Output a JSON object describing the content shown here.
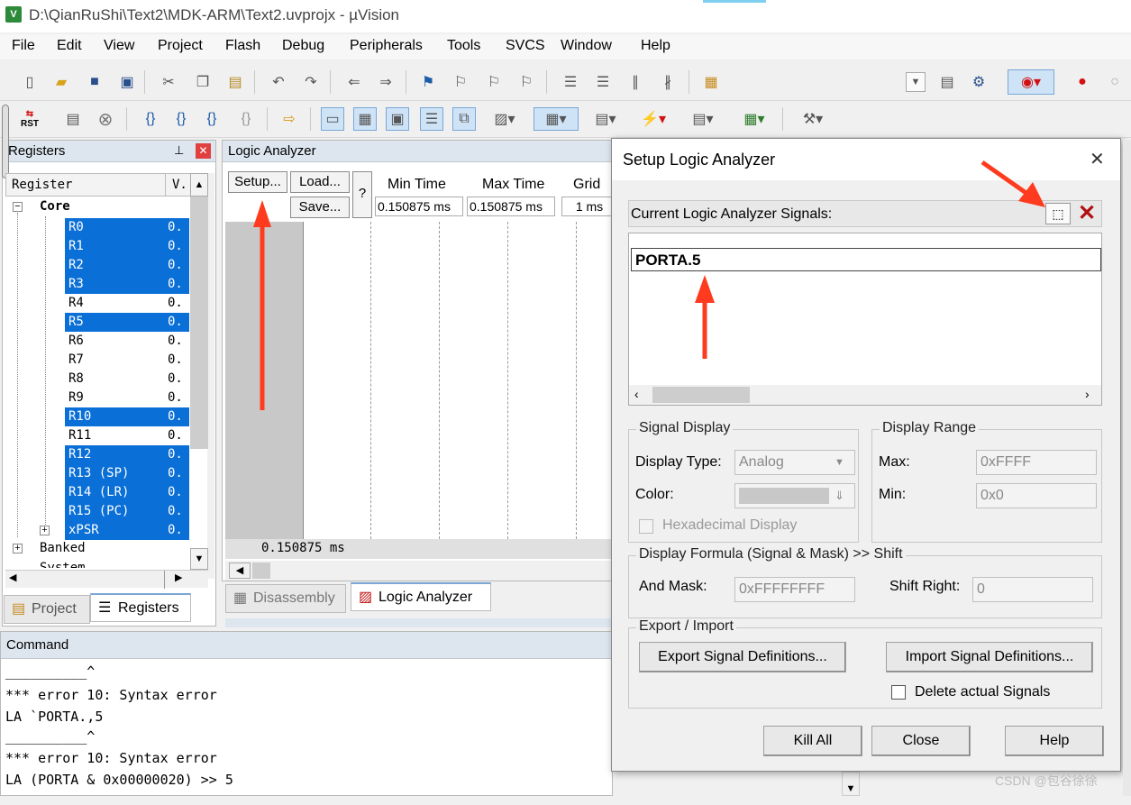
{
  "window": {
    "title": "D:\\QianRuShi\\Text2\\MDK-ARM\\Text2.uvprojx - µVision",
    "app_icon": "V"
  },
  "menu": [
    "File",
    "Edit",
    "View",
    "Project",
    "Flash",
    "Debug",
    "Peripherals",
    "Tools",
    "SVCS",
    "Window",
    "Help"
  ],
  "toolbar": {
    "rst_label": "RST"
  },
  "registers": {
    "title": "Registers",
    "col_register": "Register",
    "col_value": "V.",
    "group_core": "Core",
    "rows": [
      {
        "name": "R0",
        "val": "0.",
        "sel": true
      },
      {
        "name": "R1",
        "val": "0.",
        "sel": true
      },
      {
        "name": "R2",
        "val": "0.",
        "sel": true
      },
      {
        "name": "R3",
        "val": "0.",
        "sel": true
      },
      {
        "name": "R4",
        "val": "0.",
        "sel": false
      },
      {
        "name": "R5",
        "val": "0.",
        "sel": true
      },
      {
        "name": "R6",
        "val": "0.",
        "sel": false
      },
      {
        "name": "R7",
        "val": "0.",
        "sel": false
      },
      {
        "name": "R8",
        "val": "0.",
        "sel": false
      },
      {
        "name": "R9",
        "val": "0.",
        "sel": false
      },
      {
        "name": "R10",
        "val": "0.",
        "sel": true
      },
      {
        "name": "R11",
        "val": "0.",
        "sel": false
      },
      {
        "name": "R12",
        "val": "0.",
        "sel": true
      },
      {
        "name": "R13 (SP)",
        "val": "0.",
        "sel": true
      },
      {
        "name": "R14 (LR)",
        "val": "0.",
        "sel": true
      },
      {
        "name": "R15 (PC)",
        "val": "0.",
        "sel": true
      },
      {
        "name": "xPSR",
        "val": "0.",
        "sel": true
      }
    ],
    "group_banked": "Banked",
    "group_system": "System",
    "tab_project": "Project",
    "tab_registers": "Registers"
  },
  "logic_analyzer": {
    "title": "Logic Analyzer",
    "setup": "Setup...",
    "load": "Load...",
    "save": "Save...",
    "help": "?",
    "min_time_label": "Min Time",
    "max_time_label": "Max Time",
    "grid_label": "Grid",
    "min_time": "0.150875 ms",
    "max_time": "0.150875 ms",
    "grid": "1 ms",
    "cursor_time": "0.150875 ms",
    "tab_disassembly": "Disassembly",
    "tab_logic": "Logic Analyzer"
  },
  "command": {
    "title": "Command",
    "lines": [
      "__________^",
      "*** error 10: Syntax error",
      "LA `PORTA.,5",
      "__________^",
      "*** error 10: Syntax error",
      "LA (PORTA & 0x00000020) >> 5"
    ]
  },
  "dialog": {
    "title": "Setup Logic Analyzer",
    "close_glyph": "✕",
    "signals_label": "Current Logic Analyzer Signals:",
    "signal": "PORTA.5",
    "signal_display": "Signal Display",
    "display_type_label": "Display Type:",
    "display_type": "Analog",
    "color_label": "Color:",
    "hex_label": "Hexadecimal Display",
    "display_range": "Display Range",
    "max_label": "Max:",
    "max": "0xFFFF",
    "min_label": "Min:",
    "min": "0x0",
    "formula_group": "Display Formula (Signal & Mask) >> Shift",
    "and_mask_label": "And Mask:",
    "and_mask": "0xFFFFFFFF",
    "shift_label": "Shift Right:",
    "shift": "0",
    "export_group": "Export / Import",
    "export_btn": "Export Signal Definitions...",
    "import_btn": "Import Signal Definitions...",
    "delete_label": "Delete actual Signals",
    "kill_all": "Kill All",
    "close": "Close",
    "help": "Help"
  },
  "watermark": "CSDN @包谷徐徐",
  "colors": {
    "selection": "#0a6fd6",
    "annotation_arrow": "#ff3b1f",
    "panel_title": "#dde6ef"
  }
}
